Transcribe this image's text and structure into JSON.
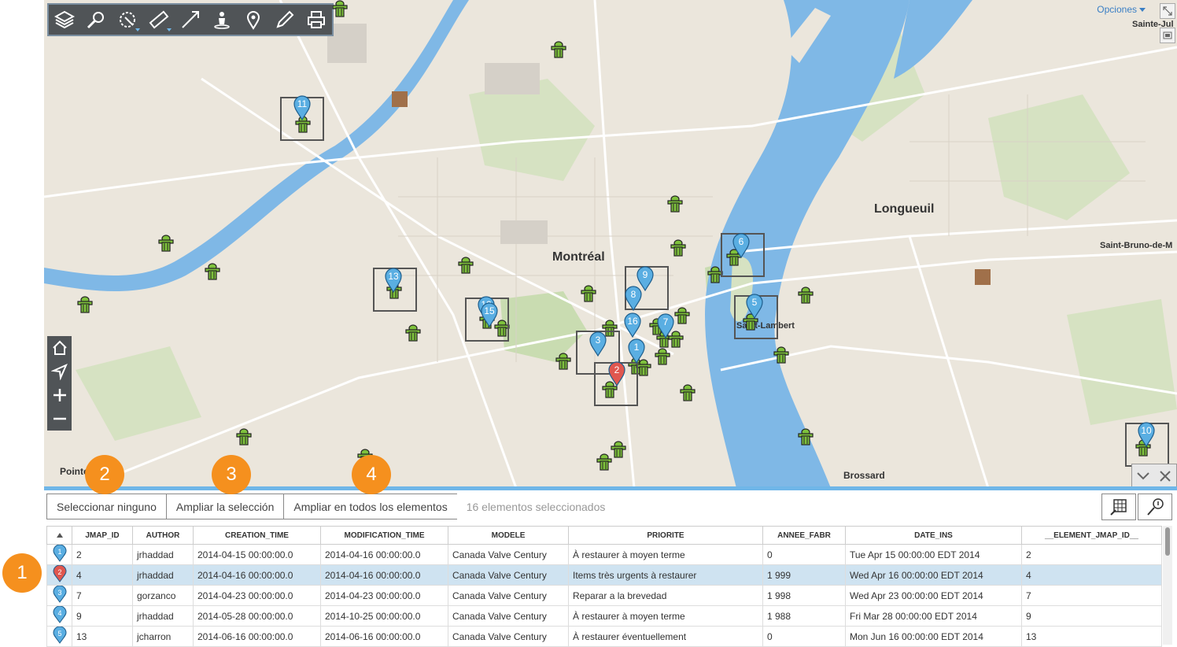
{
  "map": {
    "options_label": "Opciones",
    "place_labels": {
      "montreal": "Montréal",
      "longueuil": "Longueuil",
      "saint_lambert": "Saint-Lambert",
      "brossard": "Brossard",
      "saint_bruno": "Saint-Bruno-de-M",
      "sainte_jul": "Sainte-Jul",
      "pointe": "Pointe"
    },
    "markers": [
      "1",
      "2",
      "3",
      "5",
      "6",
      "7",
      "8",
      "9",
      "10",
      "11",
      "12",
      "13",
      "15",
      "16"
    ],
    "toolbar_icons": [
      "layers-icon",
      "search-icon",
      "select-icon",
      "measure-icon",
      "route-icon",
      "streetview-icon",
      "location-pin-icon",
      "edit-icon",
      "print-icon"
    ],
    "nav_icons": [
      "home-icon",
      "locate-icon",
      "zoom-in-icon",
      "zoom-out-icon"
    ]
  },
  "tutorial_badges": {
    "b1": "1",
    "b2": "2",
    "b3": "3",
    "b4": "4"
  },
  "actions": {
    "select_none": "Seleccionar ninguno",
    "zoom_selection": "Ampliar la selección",
    "zoom_all": "Ampliar en todos los elementos",
    "selected_count": "16 elementos seleccionados"
  },
  "table": {
    "columns": [
      "JMAP_ID",
      "AUTHOR",
      "CREATION_TIME",
      "MODIFICATION_TIME",
      "MODELE",
      "PRIORITE",
      "ANNEE_FABR",
      "DATE_INS",
      "__ELEMENT_JMAP_ID__"
    ],
    "rows": [
      {
        "marker": "1",
        "color": "blue",
        "cells": [
          "2",
          "jrhaddad",
          "2014-04-15 00:00:00.0",
          "2014-04-16 00:00:00.0",
          "Canada Valve Century",
          "À restaurer à moyen terme",
          "0",
          "Tue Apr 15 00:00:00 EDT 2014",
          "2"
        ]
      },
      {
        "marker": "2",
        "color": "red",
        "selected": true,
        "cells": [
          "4",
          "jrhaddad",
          "2014-04-16 00:00:00.0",
          "2014-04-16 00:00:00.0",
          "Canada Valve Century",
          "Items très urgents à restaurer",
          "1 999",
          "Wed Apr 16 00:00:00 EDT 2014",
          "4"
        ]
      },
      {
        "marker": "3",
        "color": "blue",
        "cells": [
          "7",
          "gorzanco",
          "2014-04-23 00:00:00.0",
          "2014-04-23 00:00:00.0",
          "Canada Valve Century",
          "Reparar a la brevedad",
          "1 998",
          "Wed Apr 23 00:00:00 EDT 2014",
          "7"
        ]
      },
      {
        "marker": "4",
        "color": "blue",
        "cells": [
          "9",
          "jrhaddad",
          "2014-05-28 00:00:00.0",
          "2014-10-25 00:00:00.0",
          "Canada Valve Century",
          "À restaurer à moyen terme",
          "1 988",
          "Fri Mar 28 00:00:00 EDT 2014",
          "9"
        ]
      },
      {
        "marker": "5",
        "color": "blue",
        "cells": [
          "13",
          "jcharron",
          "2014-06-16 00:00:00.0",
          "2014-06-16 00:00:00.0",
          "Canada Valve Century",
          "À restaurer éventuellement",
          "0",
          "Mon Jun 16 00:00:00 EDT 2014",
          "13"
        ]
      }
    ]
  },
  "colors": {
    "accent": "#6fb6e8",
    "marker_blue": "#5aaee2",
    "marker_red": "#e0574f",
    "badge": "#f5901e",
    "water": "#7fb8e6",
    "selected_row": "#cfe3f1"
  }
}
